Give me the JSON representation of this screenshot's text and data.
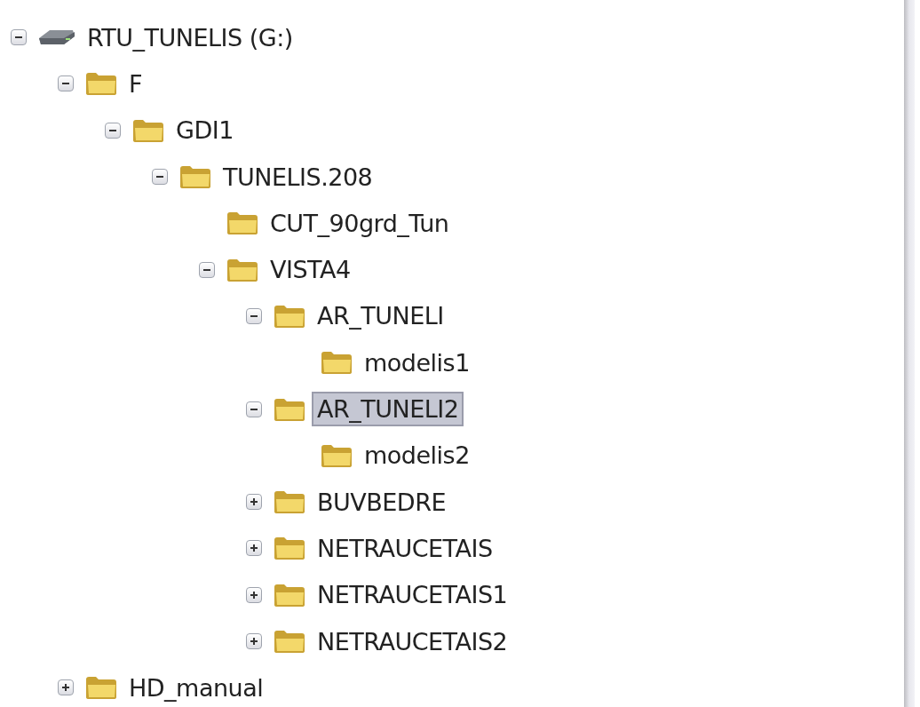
{
  "tree": [
    {
      "label": "RTU_TUNELIS (G:)",
      "kind": "drive",
      "expanded": true,
      "selected": false,
      "children": [
        {
          "label": "F",
          "kind": "folder",
          "expanded": true,
          "selected": false,
          "children": [
            {
              "label": "GDI1",
              "kind": "folder",
              "expanded": true,
              "selected": false,
              "children": [
                {
                  "label": "TUNELIS.208",
                  "kind": "folder",
                  "expanded": true,
                  "selected": false,
                  "children": [
                    {
                      "label": "CUT_90grd_Tun",
                      "kind": "folder",
                      "selected": false
                    },
                    {
                      "label": "VISTA4",
                      "kind": "folder",
                      "expanded": true,
                      "selected": false,
                      "children": [
                        {
                          "label": "AR_TUNELI",
                          "kind": "folder",
                          "expanded": true,
                          "selected": false,
                          "children": [
                            {
                              "label": "modelis1",
                              "kind": "folder",
                              "selected": false
                            }
                          ]
                        },
                        {
                          "label": "AR_TUNELI2",
                          "kind": "folder",
                          "expanded": true,
                          "selected": true,
                          "children": [
                            {
                              "label": "modelis2",
                              "kind": "folder",
                              "selected": false
                            }
                          ]
                        },
                        {
                          "label": "BUVBEDRE",
                          "kind": "folder",
                          "expanded": false,
                          "selected": false
                        },
                        {
                          "label": "NETRAUCETAIS",
                          "kind": "folder",
                          "expanded": false,
                          "selected": false
                        },
                        {
                          "label": "NETRAUCETAIS1",
                          "kind": "folder",
                          "expanded": false,
                          "selected": false
                        },
                        {
                          "label": "NETRAUCETAIS2",
                          "kind": "folder",
                          "expanded": false,
                          "selected": false
                        }
                      ]
                    }
                  ]
                }
              ]
            }
          ]
        },
        {
          "label": "HD_manual",
          "kind": "folder",
          "expanded": false,
          "selected": false
        }
      ]
    }
  ]
}
